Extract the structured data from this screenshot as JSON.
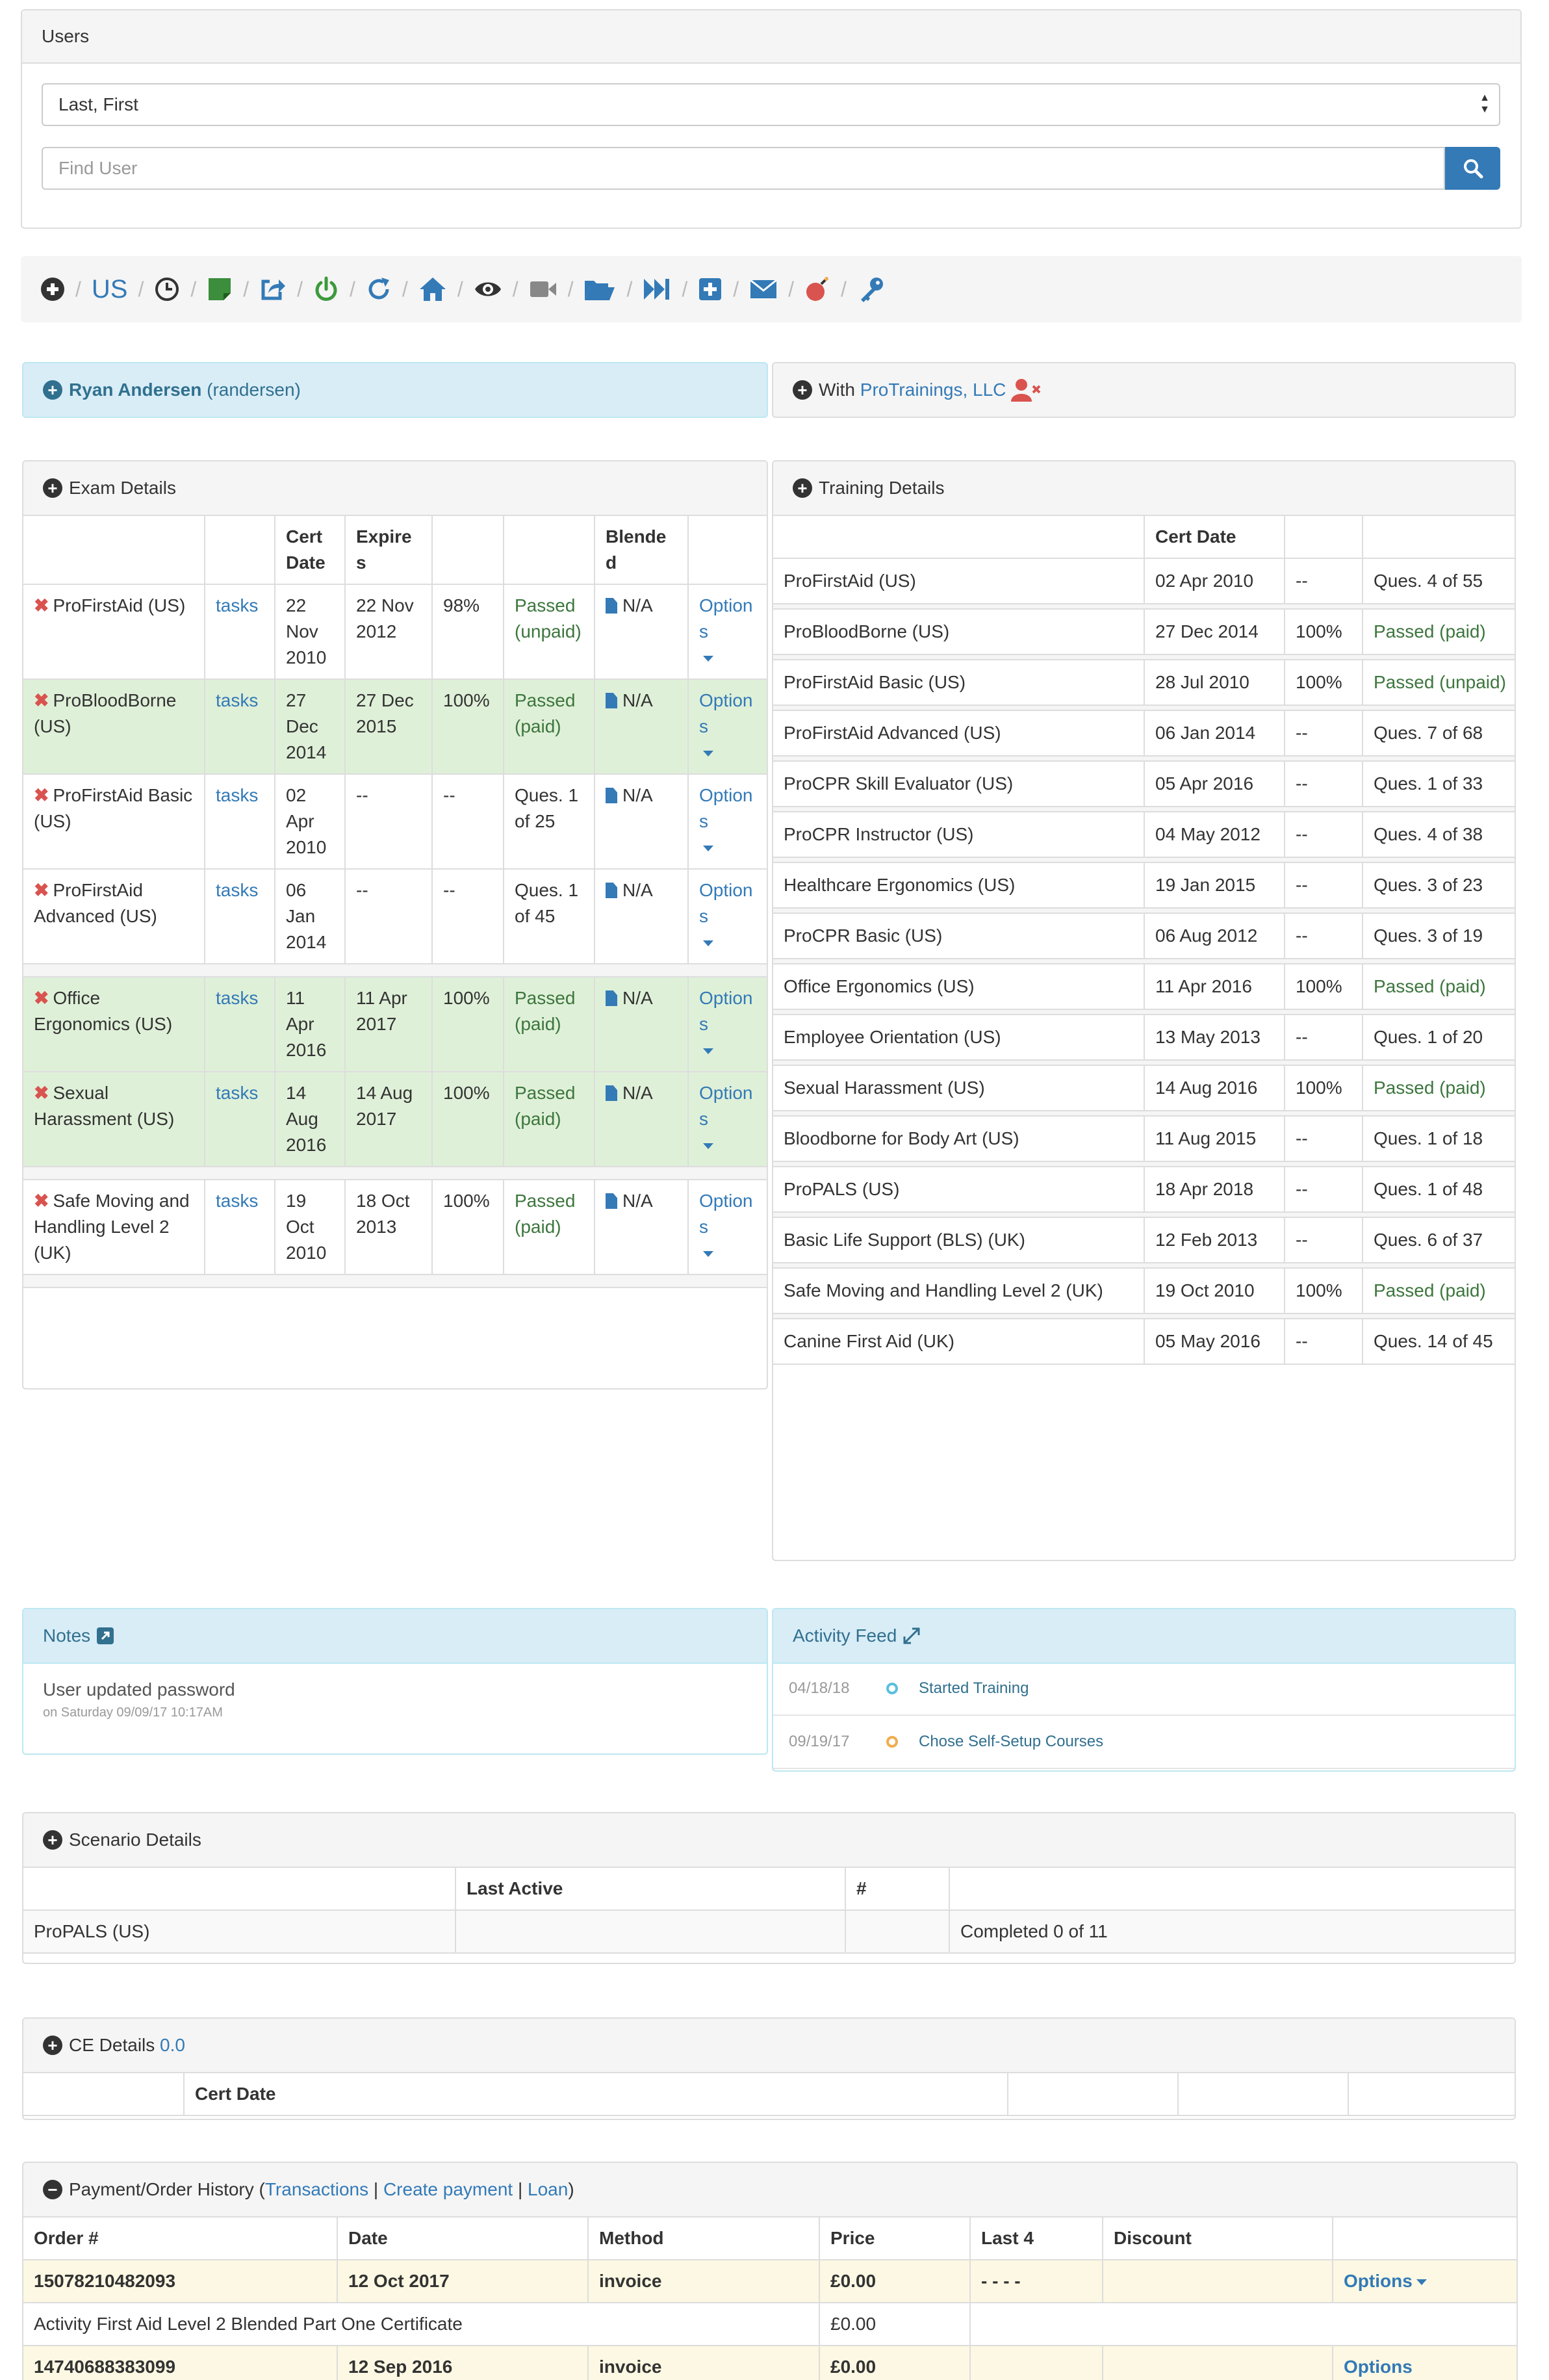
{
  "users_panel": {
    "title": "Users",
    "select_value": "Last, First",
    "search_placeholder": "Find User"
  },
  "toolbar": {
    "region": "US",
    "icons": [
      "add-icon",
      "region",
      "clock-icon",
      "note-icon",
      "share-icon",
      "power-icon",
      "refresh-icon",
      "home-icon",
      "eye-icon",
      "video-icon",
      "folder-icon",
      "fast-forward-icon",
      "plus-square-icon",
      "envelope-icon",
      "bomb-icon",
      "key-icon"
    ]
  },
  "user": {
    "name": "Ryan Andersen",
    "username": "(randersen)",
    "with_label": "With",
    "org": "ProTrainings, LLC"
  },
  "exam": {
    "title": "Exam Details",
    "headers": [
      "",
      "",
      "Cert Date",
      "Expires",
      "",
      "",
      "Blended",
      ""
    ],
    "rows": [
      {
        "course": "ProFirstAid (US)",
        "tasks": "tasks",
        "cert": "22 Nov 2010",
        "expires": "22 Nov 2012",
        "score": "98%",
        "status": "Passed (unpaid)",
        "status_type": "pass",
        "blended": "N/A",
        "options": "Options",
        "green": false
      },
      {
        "course": "ProBloodBorne (US)",
        "tasks": "tasks",
        "cert": "27 Dec 2014",
        "expires": "27 Dec 2015",
        "score": "100%",
        "status": "Passed (paid)",
        "status_type": "pass",
        "blended": "N/A",
        "options": "Options",
        "green": true
      },
      {
        "course": "ProFirstAid Basic (US)",
        "tasks": "tasks",
        "cert": "02 Apr 2010",
        "expires": "--",
        "score": "--",
        "status": "Ques. 1 of 25",
        "status_type": "plain",
        "blended": "N/A",
        "options": "Options",
        "green": false
      },
      {
        "course": "ProFirstAid Advanced (US)",
        "tasks": "tasks",
        "cert": "06 Jan 2014",
        "expires": "--",
        "score": "--",
        "status": "Ques. 1 of 45",
        "status_type": "plain",
        "blended": "N/A",
        "options": "Options",
        "green": false
      },
      {
        "sep": true
      },
      {
        "course": "Office Ergonomics (US)",
        "tasks": "tasks",
        "cert": "11 Apr 2016",
        "expires": "11 Apr 2017",
        "score": "100%",
        "status": "Passed (paid)",
        "status_type": "pass",
        "blended": "N/A",
        "options": "Options",
        "green": true
      },
      {
        "course": "Sexual Harassment (US)",
        "tasks": "tasks",
        "cert": "14 Aug 2016",
        "expires": "14 Aug 2017",
        "score": "100%",
        "status": "Passed (paid)",
        "status_type": "pass",
        "blended": "N/A",
        "options": "Options",
        "green": true
      },
      {
        "sep": true
      },
      {
        "course": "Safe Moving and Handling Level 2 (UK)",
        "tasks": "tasks",
        "cert": "19 Oct 2010",
        "expires": "18 Oct 2013",
        "score": "100%",
        "status": "Passed (paid)",
        "status_type": "pass",
        "blended": "N/A",
        "options": "Options",
        "green": false
      },
      {
        "sep": true
      }
    ]
  },
  "training": {
    "title": "Training Details",
    "headers": [
      "",
      "Cert Date",
      "",
      ""
    ],
    "rows": [
      {
        "course": "ProFirstAid (US)",
        "cert": "02 Apr 2010",
        "score": "--",
        "status": "Ques. 4 of 55",
        "pass": false
      },
      {
        "course": "ProBloodBorne (US)",
        "cert": "27 Dec 2014",
        "score": "100%",
        "status": "Passed (paid)",
        "pass": true
      },
      {
        "course": "ProFirstAid Basic (US)",
        "cert": "28 Jul 2010",
        "score": "100%",
        "status": "Passed (unpaid)",
        "pass": true
      },
      {
        "course": "ProFirstAid Advanced (US)",
        "cert": "06 Jan 2014",
        "score": "--",
        "status": "Ques. 7 of 68",
        "pass": false
      },
      {
        "course": "ProCPR Skill Evaluator (US)",
        "cert": "05 Apr 2016",
        "score": "--",
        "status": "Ques. 1 of 33",
        "pass": false
      },
      {
        "course": "ProCPR Instructor (US)",
        "cert": "04 May 2012",
        "score": "--",
        "status": "Ques. 4 of 38",
        "pass": false
      },
      {
        "course": "Healthcare Ergonomics (US)",
        "cert": "19 Jan 2015",
        "score": "--",
        "status": "Ques. 3 of 23",
        "pass": false
      },
      {
        "course": "ProCPR Basic (US)",
        "cert": "06 Aug 2012",
        "score": "--",
        "status": "Ques. 3 of 19",
        "pass": false
      },
      {
        "course": "Office Ergonomics (US)",
        "cert": "11 Apr 2016",
        "score": "100%",
        "status": "Passed (paid)",
        "pass": true
      },
      {
        "course": "Employee Orientation (US)",
        "cert": "13 May 2013",
        "score": "--",
        "status": "Ques. 1 of 20",
        "pass": false
      },
      {
        "course": "Sexual Harassment (US)",
        "cert": "14 Aug 2016",
        "score": "100%",
        "status": "Passed (paid)",
        "pass": true
      },
      {
        "course": "Bloodborne for Body Art (US)",
        "cert": "11 Aug 2015",
        "score": "--",
        "status": "Ques. 1 of 18",
        "pass": false
      },
      {
        "course": "ProPALS (US)",
        "cert": "18 Apr 2018",
        "score": "--",
        "status": "Ques. 1 of 48",
        "pass": false
      },
      {
        "course": "Basic Life Support (BLS) (UK)",
        "cert": "12 Feb 2013",
        "score": "--",
        "status": "Ques. 6 of 37",
        "pass": false
      },
      {
        "course": "Safe Moving and Handling Level 2 (UK)",
        "cert": "19 Oct 2010",
        "score": "100%",
        "status": "Passed (paid)",
        "pass": true
      },
      {
        "course": "Canine First Aid (UK)",
        "cert": "05 May 2016",
        "score": "--",
        "status": "Ques. 14 of 45",
        "pass": false
      }
    ]
  },
  "notes": {
    "title": "Notes",
    "text": "User updated password",
    "meta": "on Saturday 09/09/17 10:17AM"
  },
  "activity": {
    "title": "Activity Feed",
    "items": [
      {
        "date": "04/18/18",
        "text": "Started Training",
        "color": "#5bc0de"
      },
      {
        "date": "09/19/17",
        "text": "Chose Self-Setup Courses",
        "color": "#f0ad4e"
      }
    ]
  },
  "scenario": {
    "title": "Scenario Details",
    "headers": [
      "",
      "Last Active",
      "#",
      ""
    ],
    "rows": [
      {
        "course": "ProPALS (US)",
        "last": "",
        "num": "",
        "status": "Completed 0 of 11"
      }
    ]
  },
  "ce": {
    "title": "CE Details",
    "value": "0.0",
    "headers": [
      "",
      "Cert Date",
      "",
      "",
      ""
    ]
  },
  "payment": {
    "title": "Payment/Order History (",
    "links": [
      "Transactions",
      "Create payment",
      "Loan"
    ],
    "close": ")",
    "headers": [
      "Order #",
      "Date",
      "Method",
      "Price",
      "Last 4",
      "Discount",
      ""
    ],
    "order": {
      "number": "15078210482093",
      "date": "12 Oct 2017",
      "method": "invoice",
      "price": "£0.00",
      "last4": "- - - -",
      "discount": "",
      "options": "Options"
    },
    "item": {
      "name": "Activity First Aid Level 2 Blended Part One Certificate",
      "price": "£0.00"
    },
    "next": {
      "number": "14740688383099",
      "date": "12 Sep 2016",
      "method": "invoice",
      "price": "£0.00",
      "options": "Options"
    }
  }
}
